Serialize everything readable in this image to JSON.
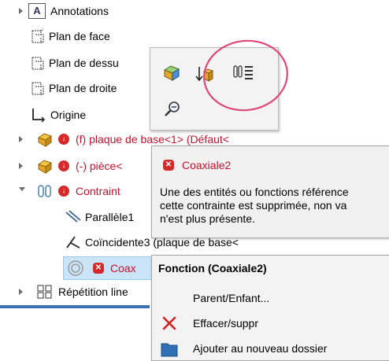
{
  "tree": {
    "annotations": "Annotations",
    "plan_face": "Plan de face",
    "plan_dessus": "Plan de dessu",
    "plan_droite": "Plan de droite",
    "origine": "Origine",
    "plaque_base": "(f) plaque de base<1> (Défaut<",
    "piece": "(-) pièce<",
    "contraintes": "Contraint",
    "parallele": "Parallèle1",
    "coincidente": "Coïncidente3 (plaque de base<",
    "coaxiale": "Coax",
    "repetition": "Répétition line"
  },
  "tooltip": {
    "title": "Coaxiale2",
    "message": "Une des entités ou fonctions référence\ncette contrainte est supprimée, non va\nn'est plus présente."
  },
  "context_menu": {
    "header": "Fonction (Coaxiale2)",
    "items": [
      "Parent/Enfant...",
      "Effacer/suppr",
      "Ajouter au nouveau dossier"
    ]
  },
  "colors": {
    "error": "#c8102e",
    "selection": "#cce4f7",
    "highlight_circle": "#e0457b",
    "accent": "#3c6fb3"
  }
}
